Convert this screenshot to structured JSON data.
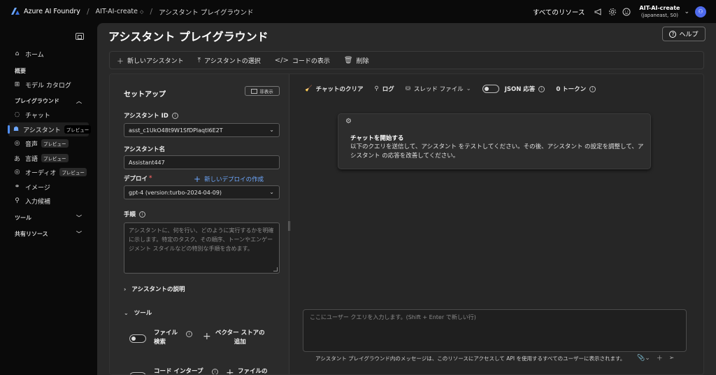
{
  "topbar": {
    "brand": "Azure AI Foundry",
    "project": "AIT-AI-create",
    "page": "アシスタント プレイグラウンド",
    "all_resources": "すべてのリソース",
    "account_name": "AIT-AI-create",
    "account_region": "(japaneast, S0)"
  },
  "sidebar": {
    "items": [
      {
        "label": "ホーム",
        "icon": "home-icon"
      },
      {
        "label": "概要",
        "section": true
      },
      {
        "label": "モデル カタログ",
        "icon": "catalog-icon"
      },
      {
        "label": "プレイグラウンド",
        "section": true
      },
      {
        "label": "チャット",
        "icon": "chat-icon"
      },
      {
        "label": "アシスタント",
        "icon": "assistant-icon",
        "badge": "プレビュー",
        "active": true
      },
      {
        "label": "音声",
        "icon": "speech-icon",
        "badge": "プレビュー"
      },
      {
        "label": "言語",
        "icon": "language-icon",
        "badge": "プレビュー"
      },
      {
        "label": "オーディオ",
        "icon": "audio-icon",
        "badge": "プレビュー"
      },
      {
        "label": "イメージ",
        "icon": "image-icon"
      },
      {
        "label": "入力候補",
        "icon": "completions-icon"
      },
      {
        "label": "ツール",
        "section": true
      },
      {
        "label": "共有リソース",
        "section": true
      }
    ]
  },
  "main": {
    "title": "アシスタント プレイグラウンド",
    "help": "ヘルプ",
    "toolbar": {
      "new_assistant": "新しいアシスタント",
      "select_assistant": "アシスタントの選択",
      "view_code": "コードの表示",
      "delete": "削除"
    }
  },
  "setup": {
    "title": "セットアップ",
    "hide": "非表示",
    "assistant_id_label": "アシスタント ID",
    "assistant_id_value": "asst_c1UkO48t9W1SfDPlaqtl6E2T",
    "assistant_name_label": "アシスタント名",
    "assistant_name_value": "Assistant447",
    "deploy_label": "デプロイ",
    "new_deploy": "新しいデプロイの作成",
    "deploy_value": "gpt-4 (version:turbo-2024-04-09)",
    "instructions_label": "手順",
    "instructions_placeholder": "アシスタントに、何を行い、どのように実行するかを明確に示します。特定のタスク、その順序、トーンやエンゲージメント スタイルなどの特別な手順を含めます。",
    "description_label": "アシスタントの説明",
    "tools_label": "ツール",
    "tool_file_search_1": "ファイル",
    "tool_file_search_2": "検索",
    "vector_store_1": "ベクター ストアの",
    "vector_store_2": "追加",
    "code_interp": "コード インタープ",
    "file_add": "ファイルの"
  },
  "chat": {
    "clear": "チャットのクリア",
    "log": "ログ",
    "thread_files": "スレッド ファイル",
    "json_label": "JSON 応答",
    "tokens": "0 トークン",
    "start_title": "チャットを開始する",
    "start_desc": "以下のクエリを送信して、アシスタント をテストしてください。その後、アシスタント の設定を調整して、アシスタント の応答を改善してください。",
    "query_placeholder": "ここにユーザー クエリを入力します。(Shift + Enter で新しい行)",
    "footnote": "アシスタント プレイグラウンド内のメッセージは、このリソースにアクセスして API を使用するすべてのユーザーに表示されます。"
  },
  "colors": {
    "accent": "#4f8ef7",
    "link": "#6ea8fe",
    "required": "#e05c5c"
  }
}
